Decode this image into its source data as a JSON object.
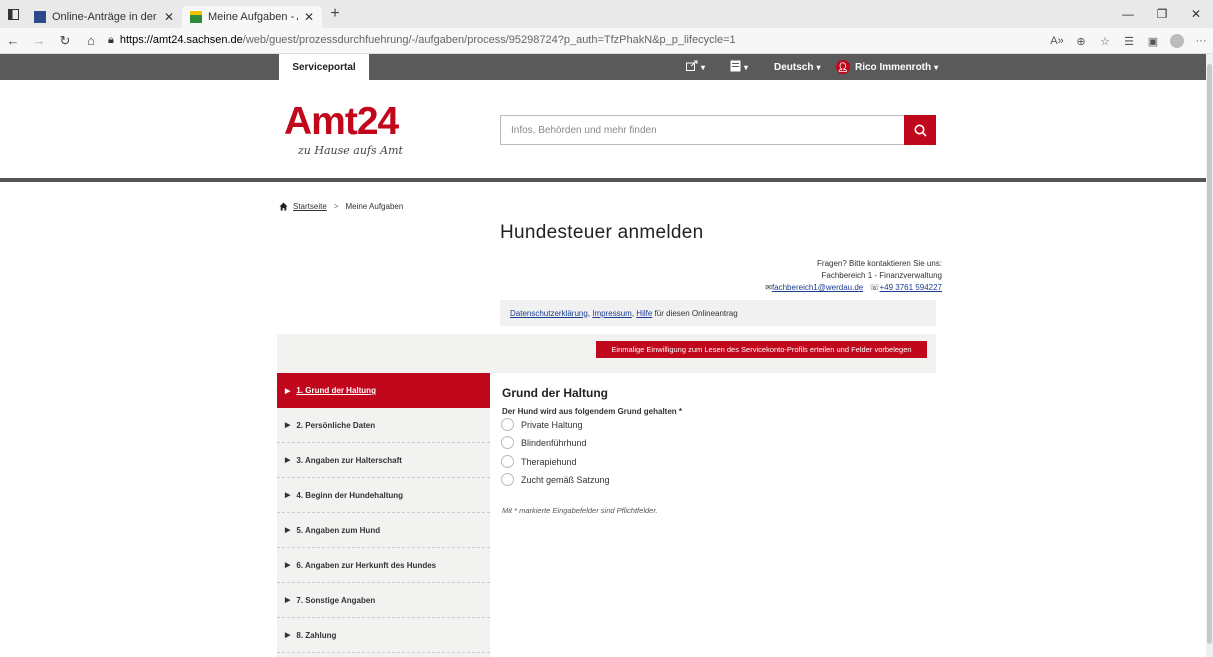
{
  "browser": {
    "tabs": [
      {
        "title": "Online-Anträge in der Stadtverw"
      },
      {
        "title": "Meine Aufgaben - Amt24"
      }
    ],
    "url_host": "https://amt24.sachsen.de",
    "url_path": "/web/guest/prozessdurchfuehrung/-/aufgaben/process/95298724?p_auth=TfzPhakN&p_p_lifecycle=1"
  },
  "topnav": {
    "serviceportal": "Serviceportal",
    "language": "Deutsch",
    "user": "Rico Immenroth"
  },
  "header": {
    "logo_text": "Amt24",
    "logo_tagline": "zu Hause aufs Amt",
    "search_placeholder": "Infos, Behörden und mehr finden"
  },
  "breadcrumb": {
    "home": "Startseite",
    "current": "Meine Aufgaben"
  },
  "page_title": "Hundesteuer anmelden",
  "contact": {
    "line1": "Fragen? Bitte kontaktieren Sie uns:",
    "line2": "Fachbereich 1 - Finanzverwaltung",
    "email": "fachbereich1@werdau.de",
    "phone": "+49 3761 594227"
  },
  "links": {
    "privacy": "Datenschutzerklärung",
    "sep1": ", ",
    "imprint": "Impressum",
    "sep2": ", ",
    "help": "Hilfe",
    "suffix": " für diesen Onlineantrag"
  },
  "consent_button": "Einmalige Einwilligung zum Lesen des Servicekonto-Profils erteilen und Felder vorbelegen",
  "steps": [
    "1. Grund der Haltung",
    "2. Persönliche Daten",
    "3. Angaben zur Halterschaft",
    "4. Beginn der Hundehaltung",
    "5. Angaben zum Hund",
    "6. Angaben zur Herkunft des Hundes",
    "7. Sonstige Angaben",
    "8. Zahlung"
  ],
  "form": {
    "title": "Grund der Haltung",
    "question": "Der Hund wird aus folgendem Grund gehalten *",
    "options": [
      "Private Haltung",
      "Blindenführhund",
      "Therapiehund",
      "Zucht gemäß Satzung"
    ],
    "note": "Mit * markierte Eingabefelder sind Pflichtfelder."
  },
  "colors": {
    "accent": "#c0071c",
    "topnav": "#5a5a5a"
  }
}
